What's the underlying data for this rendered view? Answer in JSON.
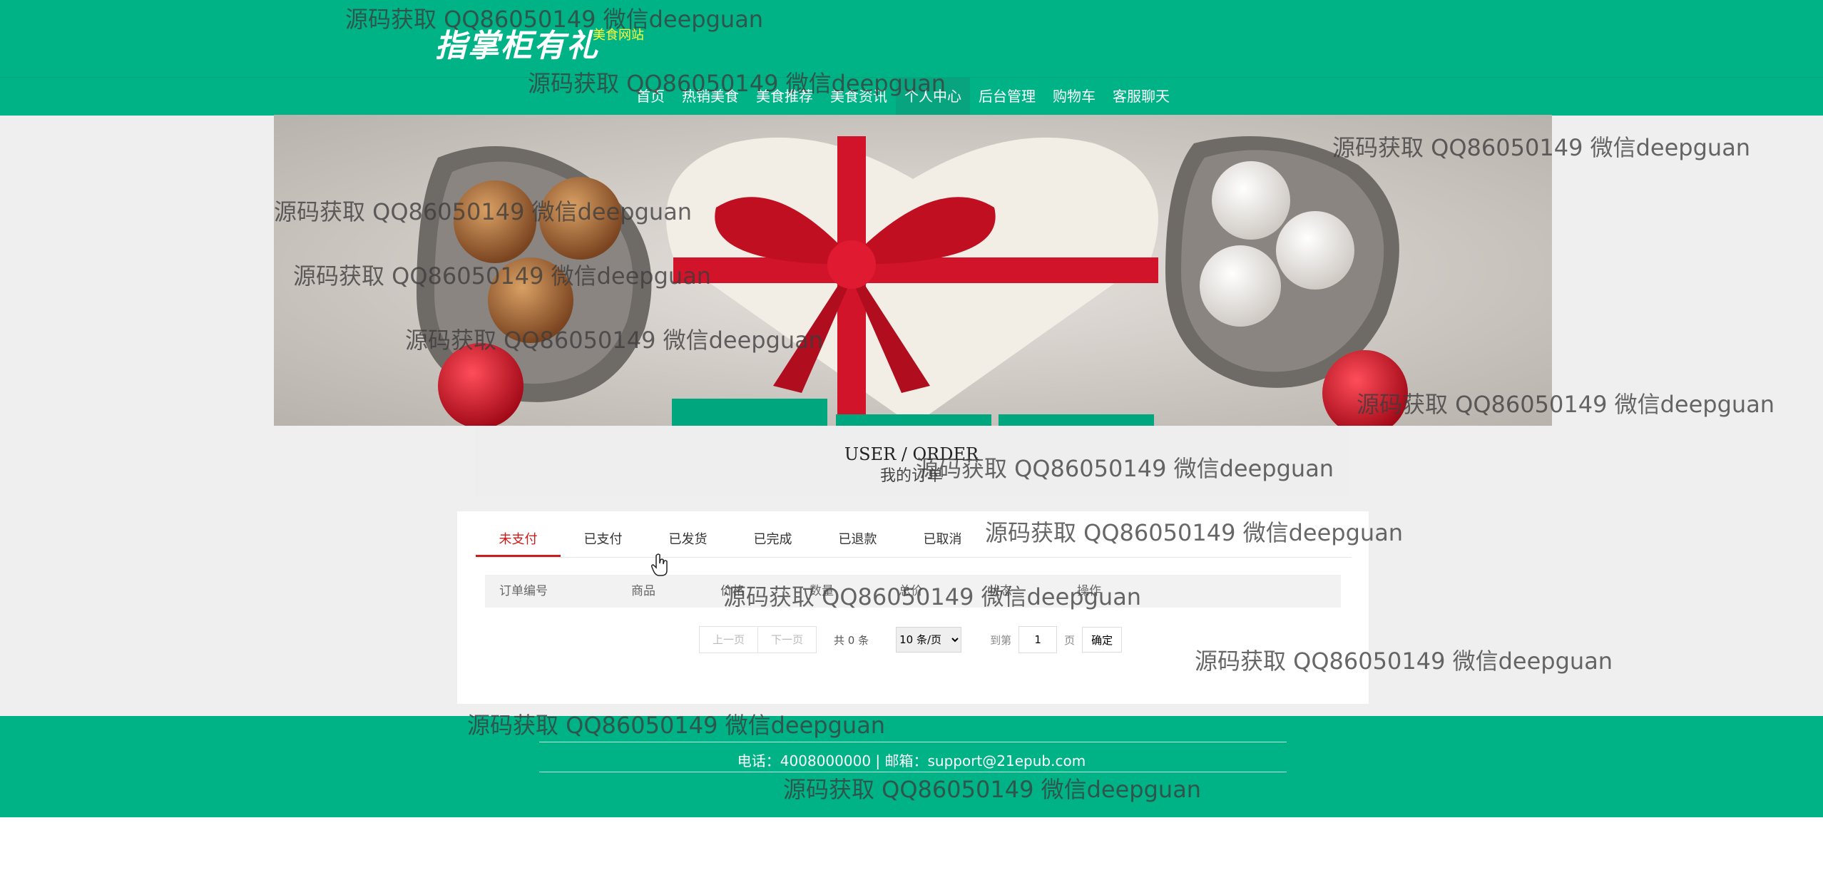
{
  "header": {
    "logo": "指掌柜有礼",
    "subtitle": "美食网站"
  },
  "nav": {
    "items": [
      {
        "label": "首页"
      },
      {
        "label": "热销美食"
      },
      {
        "label": "美食推荐"
      },
      {
        "label": "美食资讯"
      },
      {
        "label": "个人中心"
      },
      {
        "label": "后台管理"
      },
      {
        "label": "购物车"
      },
      {
        "label": "客服聊天"
      }
    ],
    "active_index": 4
  },
  "section": {
    "title_en": "USER / ORDER",
    "title_cn": "我的订单"
  },
  "tabs": [
    {
      "label": "未支付"
    },
    {
      "label": "已支付"
    },
    {
      "label": "已发货"
    },
    {
      "label": "已完成"
    },
    {
      "label": "已退款"
    },
    {
      "label": "已取消"
    }
  ],
  "active_tab_index": 0,
  "table": {
    "columns": [
      "订单编号",
      "商品",
      "价格",
      "数量",
      "总价",
      "状态",
      "操作"
    ]
  },
  "pager": {
    "prev": "上一页",
    "next": "下一页",
    "total": "共 0 条",
    "page_size": "10 条/页",
    "goto": "到第",
    "page_value": "1",
    "page_unit": "页",
    "confirm": "确定"
  },
  "footer": {
    "contact": "电话：4008000000 | 邮箱：support@21epub.com"
  },
  "watermark": "源码获取 QQ86050149 微信deepguan",
  "colors": {
    "primary": "#00b386",
    "accent": "#c81f1f",
    "subtitle": "#ffff3b"
  }
}
